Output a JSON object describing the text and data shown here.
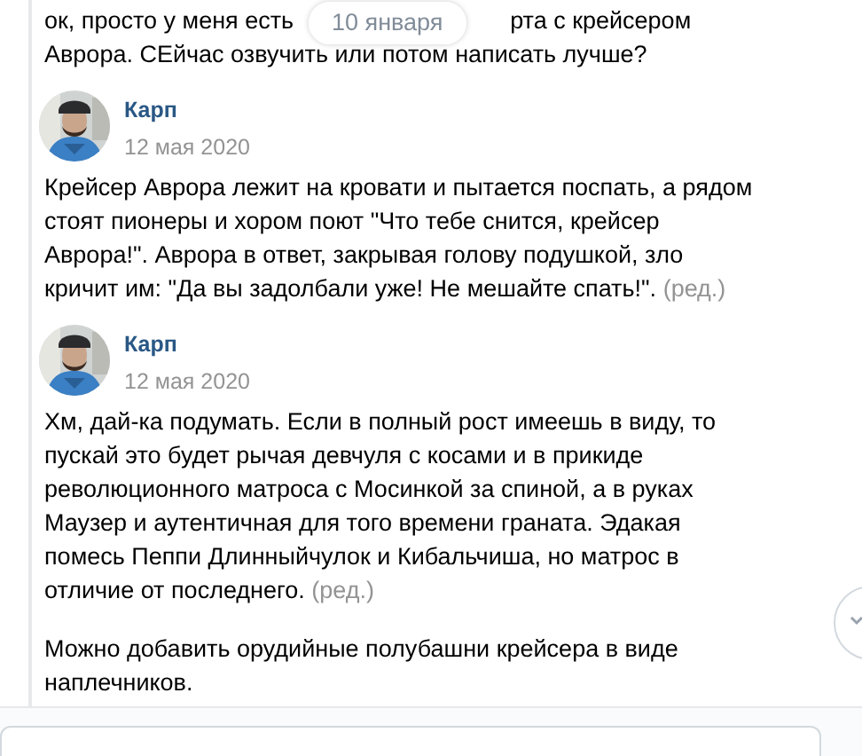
{
  "date_divider": "10 января",
  "partial_message": {
    "line_start": "ок, просто у меня есть",
    "line_end": "рта с крейсером",
    "line_2": "Аврора. СЕйчас озвучить или потом написать лучше?"
  },
  "messages": [
    {
      "kind": "post",
      "author": "Карп",
      "date": "12 мая 2020",
      "text": "Крейсер Аврора лежит на кровати и пытается поспать, а рядом стоят пионеры и хором поют \"Что тебе снится, крейсер Аврора!\". Аврора в ответ, закрывая голову подушкой, зло кричит им: \"Да вы задолбали уже! Не мешайте спать!\".",
      "edited_label": "(ред.)"
    },
    {
      "kind": "post",
      "author": "Карп",
      "date": "12 мая 2020",
      "text": "Хм, дай-ка подумать. Если в полный рост имеешь в виду, то пускай это будет рычая девчуля с косами и в прикиде революционного матроса с Мосинкой за спиной, а в руках Маузер и аутентичная для того времени граната. Эдакая помесь Пеппи Длинныйчулок и Кибальчиша, но матрос в отличие от последнего.",
      "edited_label": "(ред.)"
    },
    {
      "kind": "continuation",
      "text": "Можно добавить орудийные полубашни крейсера в виде наплечников."
    }
  ]
}
